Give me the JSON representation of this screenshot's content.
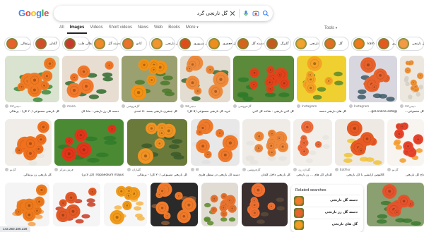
{
  "header": {
    "logo": "Google",
    "query": "گل نارنجی گرد",
    "placeholder": ""
  },
  "tabs": [
    {
      "label": "All"
    },
    {
      "label": "Images"
    },
    {
      "label": "Videos"
    },
    {
      "label": "Short videos"
    },
    {
      "label": "News"
    },
    {
      "label": "Web"
    },
    {
      "label": "Books"
    },
    {
      "label": "More"
    }
  ],
  "tools_label": "Tools",
  "chips": [
    {
      "label": "پرتقالی",
      "color": "#e8612a"
    },
    {
      "label": "گلدان",
      "color": "#d24e2b"
    },
    {
      "label": "پرتقالی قلب",
      "color": "#c73a2c"
    },
    {
      "label": "دسته گل",
      "color": "#f08b2c"
    },
    {
      "label": "کادو",
      "color": "#e9732b"
    },
    {
      "label": "گل نارنجی",
      "color": "#f3952f"
    },
    {
      "label": "گل شیپوری",
      "color": "#e04b1c"
    },
    {
      "label": "گل جعفری",
      "color": "#ee8e1e"
    },
    {
      "label": "دسته گل",
      "color": "#d5651d"
    },
    {
      "label": "گلبرگ",
      "color": "#c45a20"
    },
    {
      "label": "نارنجی",
      "color": "#f1a330"
    },
    {
      "label": "گل",
      "color": "#e26e25"
    },
    {
      "label": "kam",
      "color": "#f07a1c"
    },
    {
      "label": "جفری",
      "color": "#e55a1f"
    },
    {
      "label": "گل نارنجی",
      "color": "#f39b44"
    }
  ],
  "row1": [
    {
      "source": "دیجی‌کالا",
      "title": "گل نارنجی مصنوعی (۲۰ گل) - پرتقالی",
      "c1": "#f07a23",
      "c2": "#3d8a3a",
      "bg": "#d9e3d0"
    },
    {
      "source": "mana",
      "title": "دسته گل رز نارنجی - مانا گل",
      "c1": "#f2782a",
      "c2": "#2f6b2e",
      "bg": "#e7ddd0"
    },
    {
      "source": "گل‌فروشی",
      "title": "گل جعفری نارنجی بسته ۵۰ عددی",
      "c1": "#f29114",
      "c2": "#4a7a2a",
      "bg": "#9aa070"
    },
    {
      "source": "دیجی‌کالا",
      "title": "خرید گل نارنجی مصنوعی (۵ گل)",
      "c1": "#ee8a3a",
      "c2": "#3a6a30",
      "bg": "#e3dcd1"
    },
    {
      "source": "گل‌فروشی",
      "title": "گل لادن نارنجی - شاخه گل لادن",
      "c1": "#e2431b",
      "c2": "#2f7a2a",
      "bg": "#5a8a3a"
    },
    {
      "source": "Instagram",
      "title": "گل های نارنجی دسته",
      "c1": "#f5a324",
      "c2": "#5a8a2a",
      "bg": "#f0d030"
    },
    {
      "source": "Instagram",
      "title": "@gol.online.esta...",
      "c1": "#e8622c",
      "c2": "#3d5a66",
      "bg": "#d8d7e0"
    },
    {
      "source": "دیجی‌کالا",
      "title": "گل مصنوعی...",
      "c1": "#f3963b",
      "c2": "#d4cfc4",
      "bg": "#ece8e0"
    }
  ],
  "row2": [
    {
      "source": "گل‌نو",
      "title": "گل نارنجی رز پرتقالی",
      "c1": "#f0701e",
      "c2": "#e7e4de",
      "bg": "#f0ede8"
    },
    {
      "source": "فرش مرکز",
      "title": "Tropaeolum majus (گل لادن)",
      "c1": "#e2351a",
      "c2": "#2f7a2a",
      "bg": "#4a8a33"
    },
    {
      "source": "گلباران",
      "title": "گل نارنجی مصنوعی (۲۰ گل) - پرتقالی",
      "c1": "#f09323",
      "c2": "#3a5a2a",
      "bg": "#6a7a3a"
    },
    {
      "source": "W",
      "title": "دسته گل نارنجی در سطل فلزی",
      "c1": "#f07a2a",
      "c2": "#e0e0e0",
      "bg": "#e8e8e8"
    },
    {
      "source": "گل‌فروشی",
      "title": "گل نارنجی داخل گلدان",
      "c1": "#f0883a",
      "c2": "#e6e3dd",
      "bg": "#efece7"
    },
    {
      "source": "گلدان زرد",
      "title": "گلدان گل های ... رز نارنجی",
      "c1": "#f06c3a",
      "c2": "#e8e5e0",
      "bg": "#f2efea"
    },
    {
      "source": "EatFlor",
      "title": "کاکتوس آرایشی با گل نارنجی",
      "c1": "#e85a24",
      "c2": "#f1c338",
      "bg": "#eeeae3"
    },
    {
      "source": "گل‌نو",
      "title": "تاج گل نارنجی",
      "c1": "#e8452c",
      "c2": "#f49a2a",
      "bg": "#f8f5f0"
    }
  ],
  "row3": [
    {
      "c1": "#ee7a1c",
      "c2": "#f3a04a",
      "bg": "#f4f4f4"
    },
    {
      "c1": "#e45a26",
      "c2": "#c83a20",
      "bg": "#f5f5f5"
    },
    {
      "c1": "#f29a1a",
      "c2": "#f6b548",
      "bg": "#f6f6f6"
    },
    {
      "c1": "#f07a2a",
      "c2": "#8a5a3a",
      "bg": "#2a2a2a"
    },
    {
      "c1": "#e87430",
      "c2": "#5a8a2a",
      "bg": "#e0dcd3"
    },
    {
      "c1": "#f07030",
      "c2": "#5a4a3a",
      "bg": "#3a3030"
    },
    {
      "c1": "#e5532c",
      "c2": "#3a7a30",
      "bg": "#8aa070"
    }
  ],
  "related": {
    "heading": "Related searches",
    "items": [
      {
        "label": "دسته گل نارنجی",
        "color": "#f07a2a"
      },
      {
        "label": "دسته گل رز نارنجی",
        "color": "#e8622c"
      },
      {
        "label": "گل های نارنجی",
        "color": "#f39a22"
      }
    ]
  },
  "status_url": "142.250.185.228"
}
